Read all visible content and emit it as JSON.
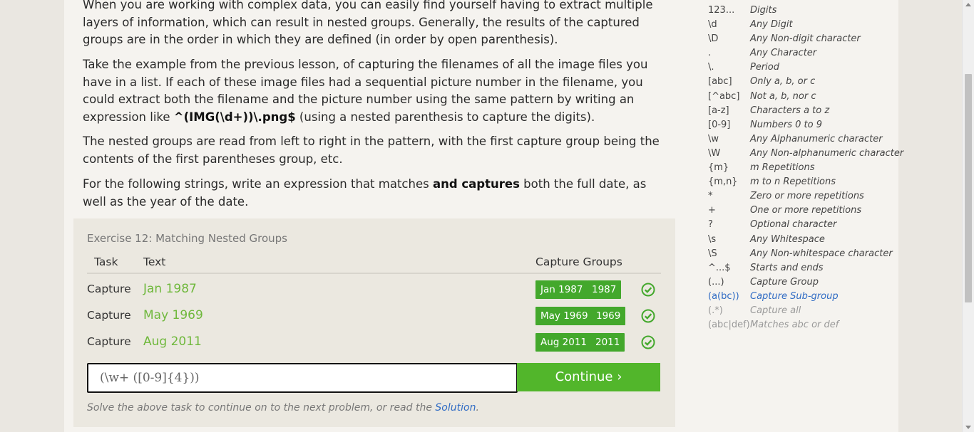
{
  "lesson": {
    "para1": "When you are working with complex data, you can easily find yourself having to extract multiple layers of information, which can result in nested groups. Generally, the results of the captured groups are in the order in which they are defined (in order by open parenthesis).",
    "para2_pre": "Take the example from the previous lesson, of capturing the filenames of all the image files you have in a list. If each of these image files had a sequential picture number in the filename, you could extract both the filename and the picture number using the same pattern by writing an expression like ",
    "para2_code": "^(IMG(\\d+))\\.png$",
    "para2_post": " (using a nested parenthesis to capture the digits).",
    "para3": "The nested groups are read from left to right in the pattern, with the first capture group being the contents of the first parentheses group, etc.",
    "para4_pre": "For the following strings, write an expression that matches ",
    "para4_bold": "and captures",
    "para4_post": " both the full date, as well as the year of the date."
  },
  "exercise": {
    "title": "Exercise 12: Matching Nested Groups",
    "headers": {
      "task": "Task",
      "text": "Text",
      "groups": "Capture Groups"
    },
    "rows": [
      {
        "task": "Capture",
        "text": "Jan 1987",
        "groups": [
          "Jan 1987",
          "1987"
        ],
        "status": "check-icon"
      },
      {
        "task": "Capture",
        "text": "May 1969",
        "groups": [
          "May 1969",
          "1969"
        ],
        "status": "check-icon"
      },
      {
        "task": "Capture",
        "text": "Aug 2011",
        "groups": [
          "Aug 2011",
          "2011"
        ],
        "status": "check-icon"
      }
    ],
    "input_value": "(\\w+ ([0-9]{4}))",
    "continue_label": "Continue ›",
    "hint_pre": "Solve the above task to continue on to the next problem, or read the ",
    "hint_link": "Solution",
    "hint_post": "."
  },
  "cheatsheet": [
    {
      "sym": "123...",
      "desc": "Digits"
    },
    {
      "sym": "\\d",
      "desc": "Any Digit"
    },
    {
      "sym": "\\D",
      "desc": "Any Non-digit character"
    },
    {
      "sym": ".",
      "desc": "Any Character"
    },
    {
      "sym": "\\.",
      "desc": "Period"
    },
    {
      "sym": "[abc]",
      "desc": "Only a, b, or c"
    },
    {
      "sym": "[^abc]",
      "desc": "Not a, b, nor c"
    },
    {
      "sym": "[a-z]",
      "desc": "Characters a to z"
    },
    {
      "sym": "[0-9]",
      "desc": "Numbers 0 to 9"
    },
    {
      "sym": "\\w",
      "desc": "Any Alphanumeric character"
    },
    {
      "sym": "\\W",
      "desc": "Any Non-alphanumeric character"
    },
    {
      "sym": "{m}",
      "desc": "m Repetitions"
    },
    {
      "sym": "{m,n}",
      "desc": "m to n Repetitions"
    },
    {
      "sym": "*",
      "desc": "Zero or more repetitions"
    },
    {
      "sym": "+",
      "desc": "One or more repetitions"
    },
    {
      "sym": "?",
      "desc": "Optional character"
    },
    {
      "sym": "\\s",
      "desc": "Any Whitespace"
    },
    {
      "sym": "\\S",
      "desc": "Any Non-whitespace character"
    },
    {
      "sym": "^...$",
      "desc": "Starts and ends"
    },
    {
      "sym": "(...)",
      "desc": "Capture Group"
    },
    {
      "sym": "(a(bc))",
      "desc": "Capture Sub-group"
    },
    {
      "sym": "(.*)",
      "desc": "Capture all"
    },
    {
      "sym": "(abc|def)",
      "desc": "Matches abc or def"
    }
  ],
  "colors": {
    "accent": "#52b62b",
    "group_bg": "#43a82c",
    "link": "#2f6bc4",
    "match_text": "#6fb83c"
  }
}
